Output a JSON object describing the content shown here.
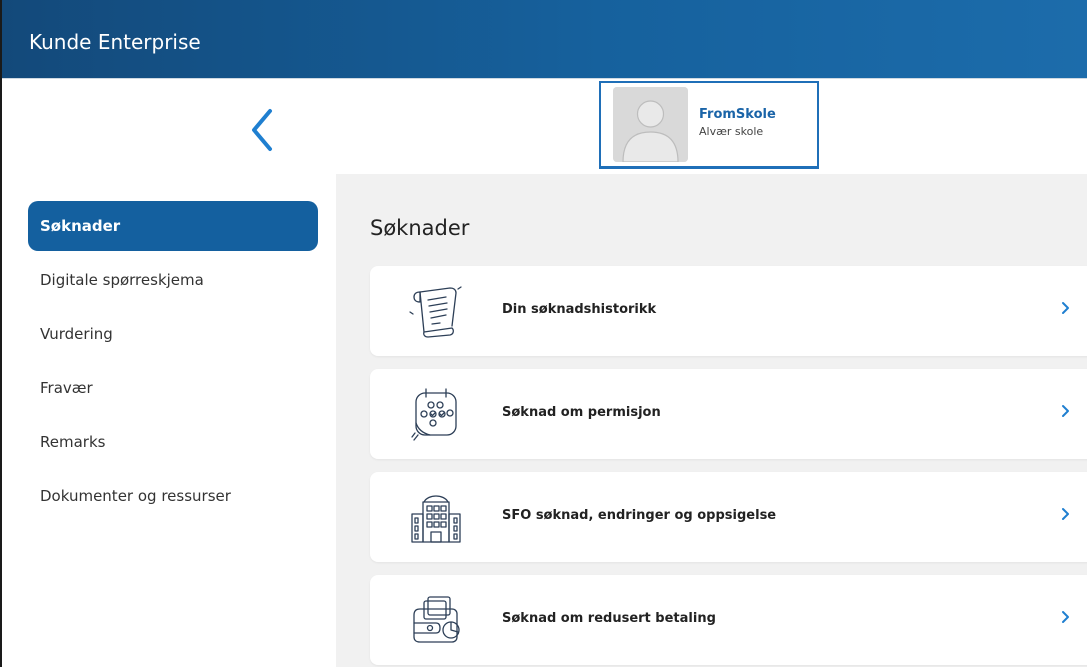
{
  "app": {
    "title": "Kunde Enterprise"
  },
  "profile": {
    "name": "FromSkole",
    "school": "Alvær skole"
  },
  "sidebar": {
    "items": [
      {
        "label": "Søknader",
        "active": true
      },
      {
        "label": "Digitale spørreskjema",
        "active": false
      },
      {
        "label": "Vurdering",
        "active": false
      },
      {
        "label": "Fravær",
        "active": false
      },
      {
        "label": "Remarks",
        "active": false
      },
      {
        "label": "Dokumenter og ressurser",
        "active": false
      }
    ]
  },
  "main": {
    "title": "Søknader",
    "cards": [
      {
        "label": "Din søknadshistorikk",
        "icon": "scroll-icon"
      },
      {
        "label": "Søknad om permisjon",
        "icon": "calendar-icon"
      },
      {
        "label": "SFO søknad, endringer og oppsigelse",
        "icon": "school-building-icon"
      },
      {
        "label": "Søknad om redusert betaling",
        "icon": "wallet-icon"
      }
    ]
  },
  "colors": {
    "topbar": "#16619d",
    "accent": "#14609f",
    "link": "#1a64a8",
    "content_bg": "#f1f1f1"
  }
}
